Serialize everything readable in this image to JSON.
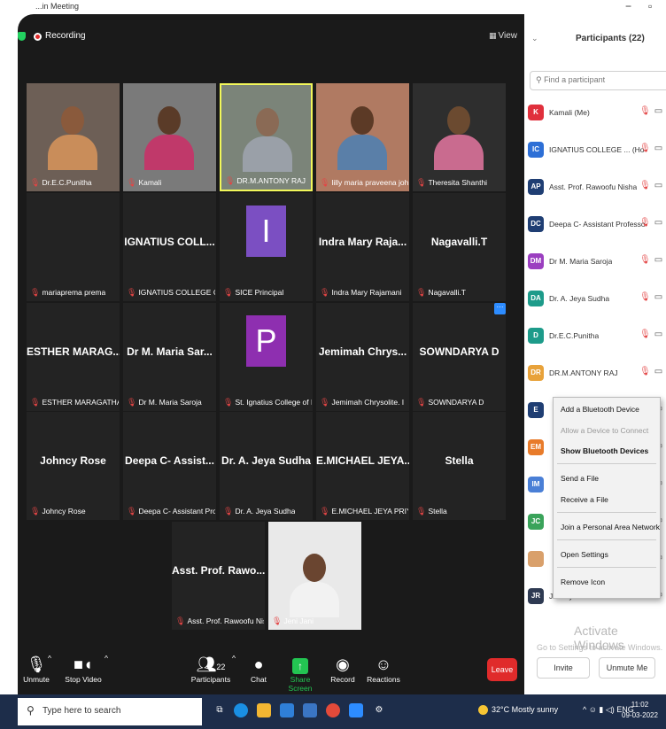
{
  "window": {
    "title": "...in Meeting",
    "minimize": "−",
    "maximize": "▫"
  },
  "meeting": {
    "recording_label": "Recording",
    "view_label": "View",
    "tiles": [
      {
        "name": "Dr.E.C.Punitha",
        "big": "",
        "kind": "video",
        "skin": "#8a5a3c",
        "cloth": "#c98d5a",
        "bg": "#6d5f56"
      },
      {
        "name": "Kamali",
        "big": "",
        "kind": "video",
        "skin": "#5a3b28",
        "cloth": "#c0396a",
        "bg": "#7a7a7a"
      },
      {
        "name": "DR.M.ANTONY RAJ",
        "big": "",
        "kind": "video-hl",
        "skin": "#8a6a55",
        "cloth": "#9aa0a8",
        "bg": "#7b8479"
      },
      {
        "name": "lilly maria praveena john",
        "big": "",
        "kind": "video",
        "skin": "#5c3a26",
        "cloth": "#5a7fa8",
        "bg": "#b07a62"
      },
      {
        "name": "Theresita Shanthi",
        "big": "",
        "kind": "video",
        "skin": "#6b4a30",
        "cloth": "#c96b8f",
        "bg": "#2e2e2e"
      },
      {
        "name": "mariaprema prema",
        "big": "",
        "kind": "blank"
      },
      {
        "name": "IGNATIUS COLLEGE OF EDU",
        "big": "IGNATIUS COLL...",
        "kind": "text"
      },
      {
        "name": "SICE Principal",
        "big": "",
        "kind": "avatar",
        "letter": "I",
        "color": "#7b4fc2"
      },
      {
        "name": "Indra Mary Rajamani",
        "big": "Indra Mary Raja...",
        "kind": "text"
      },
      {
        "name": "Nagavalli.T",
        "big": "Nagavalli.T",
        "kind": "text"
      },
      {
        "name": "ESTHER MARAGATHAMANI",
        "big": "ESTHER MARAG...",
        "kind": "text"
      },
      {
        "name": "Dr M. Maria Saroja",
        "big": "Dr M. Maria Sar...",
        "kind": "text"
      },
      {
        "name": "St. Ignatius College of Educat...",
        "big": "",
        "kind": "avatar",
        "letter": "P",
        "color": "#8e2fb0"
      },
      {
        "name": "Jemimah Chrysolite. I",
        "big": "Jemimah Chrys...",
        "kind": "text"
      },
      {
        "name": "SOWNDARYA D",
        "big": "SOWNDARYA D",
        "kind": "text-more"
      },
      {
        "name": "Johncy Rose",
        "big": "Johncy Rose",
        "kind": "text"
      },
      {
        "name": "Deepa C- Assistant Profess...",
        "big": "Deepa C- Assist...",
        "kind": "text"
      },
      {
        "name": "Dr. A. Jeya Sudha",
        "big": "Dr. A. Jeya Sudha",
        "kind": "text"
      },
      {
        "name": "E.MICHAEL JEYA PRIYA",
        "big": "E.MICHAEL JEYA...",
        "kind": "text"
      },
      {
        "name": "Stella",
        "big": "Stella",
        "kind": "text"
      },
      {
        "name": "Asst. Prof. Rawoofu Nisha",
        "big": "Asst. Prof. Rawo...",
        "kind": "text"
      },
      {
        "name": "Jeni Jani",
        "big": "",
        "kind": "video-photo",
        "skin": "#6a4530",
        "cloth": "#f2f2f2",
        "bg": "#e9e9e9"
      }
    ]
  },
  "toolbar": {
    "unmute": "Unmute",
    "stop_video": "Stop Video",
    "participants": "Participants",
    "participants_count": "22",
    "chat": "Chat",
    "share_screen": "Share Screen",
    "record": "Record",
    "reactions": "Reactions",
    "leave": "Leave"
  },
  "panel": {
    "title": "Participants (22)",
    "search_placeholder": "Find a participant",
    "rows": [
      {
        "initials": "K",
        "name": "Kamali (Me)",
        "color": "#e0303c"
      },
      {
        "initials": "IC",
        "name": "IGNATIUS COLLEGE ... (Host) ®",
        "color": "#2d6fd6"
      },
      {
        "initials": "AP",
        "name": "Asst. Prof. Rawoofu Nisha",
        "color": "#1f3e73"
      },
      {
        "initials": "DC",
        "name": "Deepa C- Assistant Professor",
        "color": "#1f3e73"
      },
      {
        "initials": "DM",
        "name": "Dr M. Maria Saroja",
        "color": "#9b3fc0"
      },
      {
        "initials": "DA",
        "name": "Dr. A. Jeya Sudha",
        "color": "#1d9b8a"
      },
      {
        "initials": "D",
        "name": "Dr.E.C.Punitha",
        "color": "#1d9b8a"
      },
      {
        "initials": "DR",
        "name": "DR.M.ANTONY RAJ",
        "color": "#e8a23a"
      },
      {
        "initials": "E",
        "name": "",
        "color": "#1f3e73"
      },
      {
        "initials": "EM",
        "name": "",
        "color": "#e87b2a"
      },
      {
        "initials": "IM",
        "name": "",
        "color": "#4a7fd6"
      },
      {
        "initials": "JC",
        "name": "",
        "color": "#3aa35a"
      },
      {
        "initials": "",
        "name": "",
        "color": "#d9a06b"
      },
      {
        "initials": "JR",
        "name": "Johncy Rose",
        "color": "#2e3a52"
      }
    ],
    "watermark_title": "Activate Windows",
    "watermark_sub": "Go to Settings to activate Windows.",
    "invite": "Invite",
    "unmute_me": "Unmute Me"
  },
  "context_menu": {
    "add_device": "Add a Bluetooth Device",
    "allow_connect": "Allow a Device to Connect",
    "show_devices": "Show Bluetooth Devices",
    "send_file": "Send a File",
    "receive_file": "Receive a File",
    "join_pan": "Join a Personal Area Network",
    "open_settings": "Open Settings",
    "remove_icon": "Remove Icon"
  },
  "taskbar": {
    "search_placeholder": "Type here to search",
    "weather": "32°C  Mostly sunny",
    "tray": "^ ☺ ▮ ◁) ENG",
    "time": "11:02",
    "date": "09-03-2022"
  }
}
